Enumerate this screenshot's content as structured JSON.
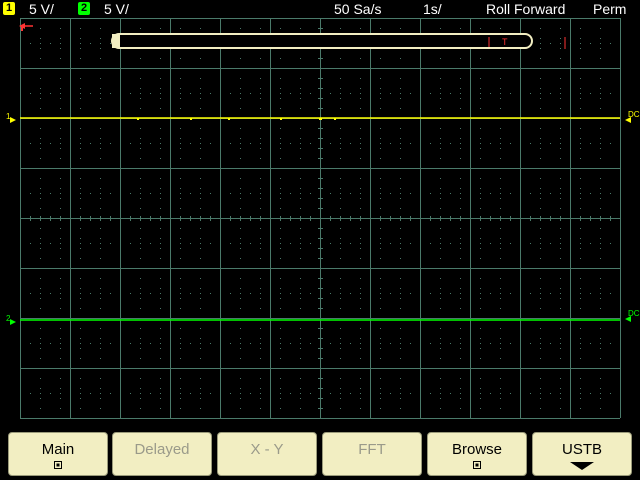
{
  "status": {
    "ch1": {
      "badge": "1",
      "scale": "5 V/",
      "color": "#ffff00"
    },
    "ch2": {
      "badge": "2",
      "scale": "5 V/",
      "color": "#00ff00"
    },
    "sample_rate": "50 Sa/s",
    "time_scale": "1s/",
    "mode": "Roll Forward",
    "persistence": "Perm"
  },
  "display": {
    "grid_color": "#4a7a6a",
    "background": "#000000",
    "trigger_marker": "T",
    "trigger_color": "#ff3333",
    "ch1_marker": "1",
    "ch2_marker": "2",
    "ch1_coupling": "DC",
    "ch2_coupling": "DC"
  },
  "softkeys": [
    {
      "label": "Main",
      "enabled": true,
      "icon": "selected-indicator-icon"
    },
    {
      "label": "Delayed",
      "enabled": false,
      "icon": ""
    },
    {
      "label": "X - Y",
      "enabled": false,
      "icon": ""
    },
    {
      "label": "FFT",
      "enabled": false,
      "icon": ""
    },
    {
      "label": "Browse",
      "enabled": true,
      "icon": "selected-indicator-icon"
    },
    {
      "label": "USTB",
      "enabled": true,
      "icon": "down-arrow-icon"
    }
  ]
}
